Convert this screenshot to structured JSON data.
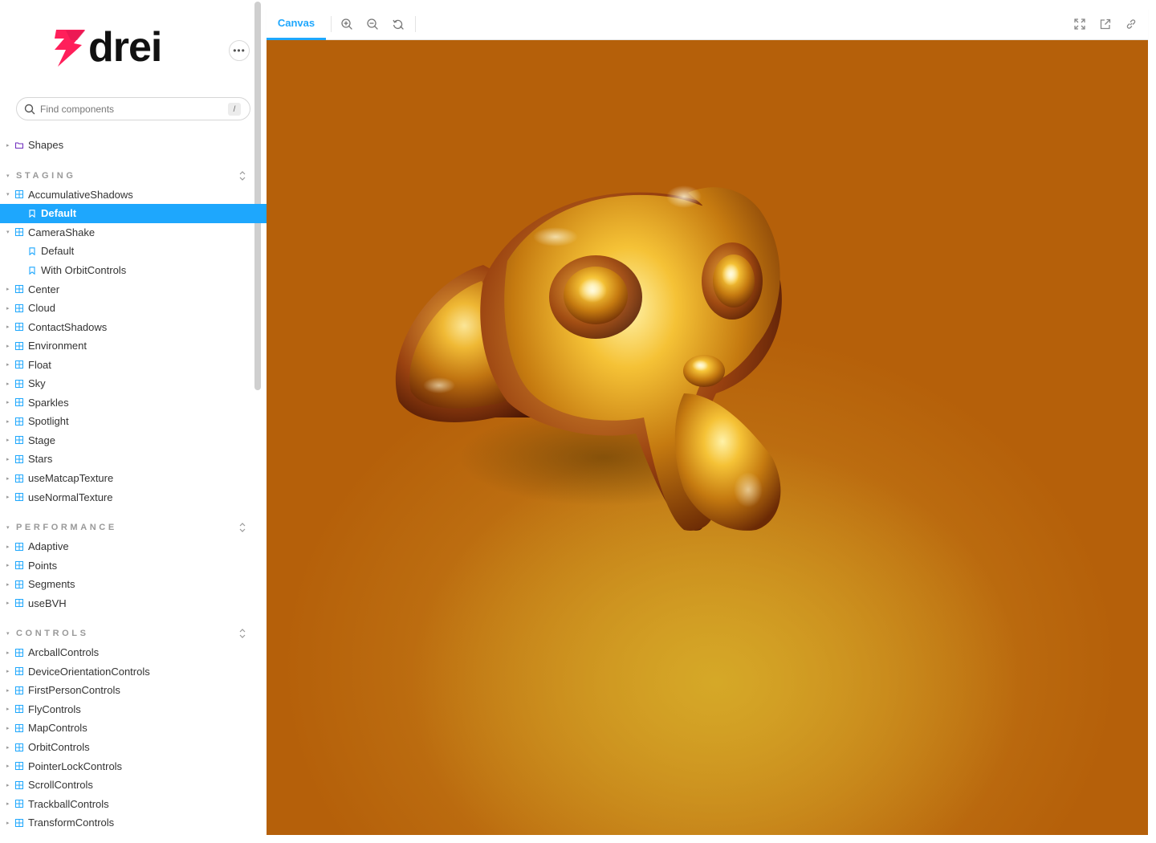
{
  "brand": {
    "logo_text": "drei",
    "logo_colors": {
      "mark": "#ff1f5a",
      "text": "#111111"
    }
  },
  "header": {
    "menu_icon": "ellipsis-icon"
  },
  "search": {
    "placeholder": "Find components",
    "shortcut": "/"
  },
  "tree": {
    "top_items": [
      {
        "label": "Shapes",
        "icon": "folder-icon"
      }
    ],
    "sections": [
      {
        "title": "STAGING",
        "items": [
          {
            "label": "AccumulativeShadows",
            "expanded": true,
            "stories": [
              {
                "label": "Default",
                "selected": true
              }
            ]
          },
          {
            "label": "CameraShake",
            "expanded": true,
            "stories": [
              {
                "label": "Default",
                "selected": false
              },
              {
                "label": "With OrbitControls",
                "selected": false
              }
            ]
          },
          {
            "label": "Center"
          },
          {
            "label": "Cloud"
          },
          {
            "label": "ContactShadows"
          },
          {
            "label": "Environment"
          },
          {
            "label": "Float"
          },
          {
            "label": "Sky"
          },
          {
            "label": "Sparkles"
          },
          {
            "label": "Spotlight"
          },
          {
            "label": "Stage"
          },
          {
            "label": "Stars"
          },
          {
            "label": "useMatcapTexture"
          },
          {
            "label": "useNormalTexture"
          }
        ]
      },
      {
        "title": "PERFORMANCE",
        "items": [
          {
            "label": "Adaptive"
          },
          {
            "label": "Points"
          },
          {
            "label": "Segments"
          },
          {
            "label": "useBVH"
          }
        ]
      },
      {
        "title": "CONTROLS",
        "items": [
          {
            "label": "ArcballControls"
          },
          {
            "label": "DeviceOrientationControls"
          },
          {
            "label": "FirstPersonControls"
          },
          {
            "label": "FlyControls"
          },
          {
            "label": "MapControls"
          },
          {
            "label": "OrbitControls"
          },
          {
            "label": "PointerLockControls"
          },
          {
            "label": "ScrollControls"
          },
          {
            "label": "TrackballControls"
          },
          {
            "label": "TransformControls"
          }
        ]
      }
    ]
  },
  "toolbar": {
    "tab_label": "Canvas",
    "left_tools": [
      "zoom-in-icon",
      "zoom-out-icon",
      "zoom-reset-icon"
    ],
    "right_tools": [
      "fullscreen-icon",
      "open-new-tab-icon",
      "copy-link-icon"
    ]
  },
  "colors": {
    "accent": "#1ea7fd",
    "canvas_bg": "#b5600a",
    "model_gold": "#d99a18"
  }
}
